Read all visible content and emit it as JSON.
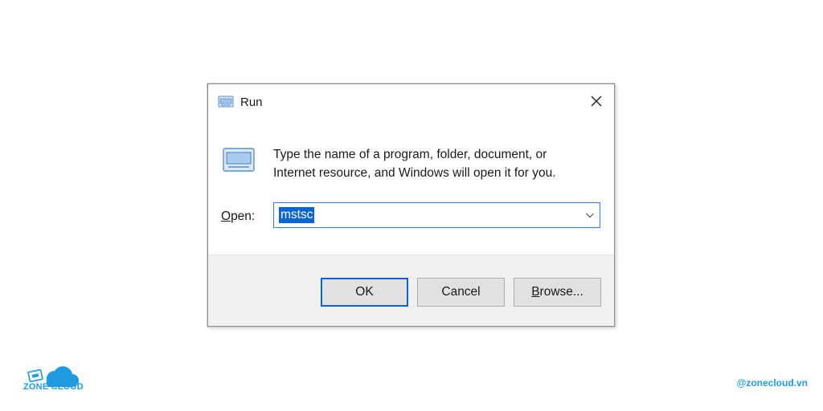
{
  "dialog": {
    "title": "Run",
    "description_line1": "Type the name of a program, folder, document, or",
    "description_line2": "Internet resource, and Windows will open it for you.",
    "open_label_mnemonic": "O",
    "open_label_rest": "pen:",
    "open_value": "mstsc",
    "buttons": {
      "ok": "OK",
      "cancel": "Cancel",
      "browse_mnemonic": "B",
      "browse_rest": "rowse..."
    },
    "icons": {
      "title": "run-icon",
      "content": "run-icon",
      "close": "close-icon",
      "dropdown": "chevron-down-icon"
    },
    "colors": {
      "accent": "#0a64d2",
      "footer": "#f0f0f0"
    }
  },
  "branding": {
    "logo_text": "ZONE CLOUD",
    "handle": "@zonecloud.vn",
    "color": "#1e9be0"
  }
}
